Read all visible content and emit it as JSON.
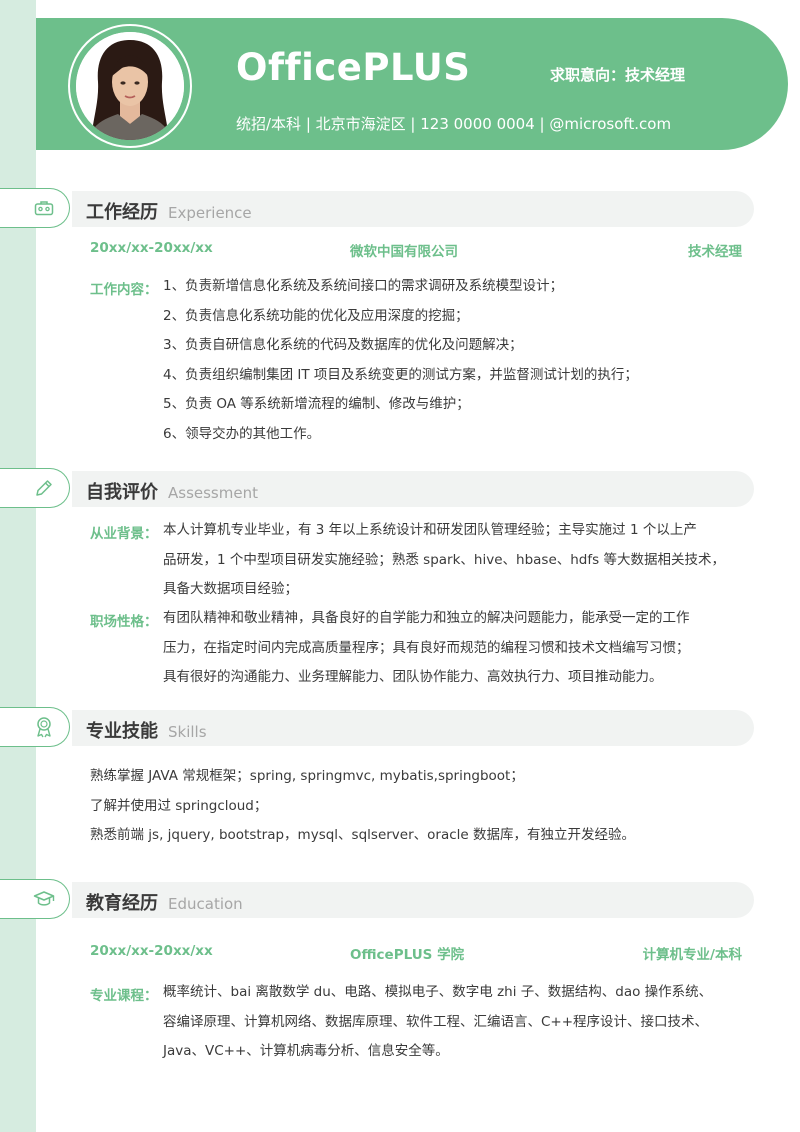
{
  "header": {
    "name": "OfficePLUS",
    "job_intent": "求职意向：技术经理",
    "contact": "统招/本科 | 北京市海淀区 | 123 0000 0004 | @microsoft.com"
  },
  "experience": {
    "title": "工作经历",
    "title_en": "Experience",
    "date": "20xx/xx-20xx/xx",
    "company": "微软中国有限公司",
    "position": "技术经理",
    "content_label": "工作内容：",
    "items": [
      "1、负责新增信息化系统及系统间接口的需求调研及系统模型设计；",
      "2、负责信息化系统功能的优化及应用深度的挖掘；",
      "3、负责自研信息化系统的代码及数据库的优化及问题解决；",
      "4、负责组织编制集团 IT 项目及系统变更的测试方案，并监督测试计划的执行；",
      "5、负责 OA 等系统新增流程的编制、修改与维护；",
      "6、领导交办的其他工作。"
    ]
  },
  "assessment": {
    "title": "自我评价",
    "title_en": "Assessment",
    "background_label": "从业背景：",
    "background_lines": [
      "本人计算机专业毕业，有 3 年以上系统设计和研发团队管理经验；主导实施过 1 个以上产",
      "品研发，1 个中型项目研发实施经验；熟悉 spark、hive、hbase、hdfs 等大数据相关技术，",
      "具备大数据项目经验；"
    ],
    "personality_label": "职场性格：",
    "personality_lines": [
      "有团队精神和敬业精神，具备良好的自学能力和独立的解决问题能力，能承受一定的工作",
      "压力，在指定时间内完成高质量程序；具有良好而规范的编程习惯和技术文档编写习惯；",
      "具有很好的沟通能力、业务理解能力、团队协作能力、高效执行力、项目推动能力。"
    ]
  },
  "skills": {
    "title": "专业技能",
    "title_en": "Skills",
    "lines": [
      "熟练掌握 JAVA 常规框架；spring, springmvc, mybatis,springboot；",
      "了解并使用过 springcloud；",
      "熟悉前端 js, jquery, bootstrap，mysql、sqlserver、oracle 数据库，有独立开发经验。"
    ]
  },
  "education": {
    "title": "教育经历",
    "title_en": "Education",
    "date": "20xx/xx-20xx/xx",
    "school": "OfficePLUS 学院",
    "major": "计算机专业/本科",
    "course_label": "专业课程：",
    "course_lines": [
      "概率统计、bai 离散数学 du、电路、模拟电子、数字电 zhi 子、数据结构、dao 操作系统、",
      "容编译原理、计算机网络、数据库原理、软件工程、汇编语言、C++程序设计、接口技术、",
      "Java、VC++、计算机病毒分析、信息安全等。"
    ]
  },
  "colors": {
    "accent": "#6dbf8b",
    "strip": "#d6ece0",
    "bar": "#f1f3f2",
    "text": "#3a3a3a"
  }
}
